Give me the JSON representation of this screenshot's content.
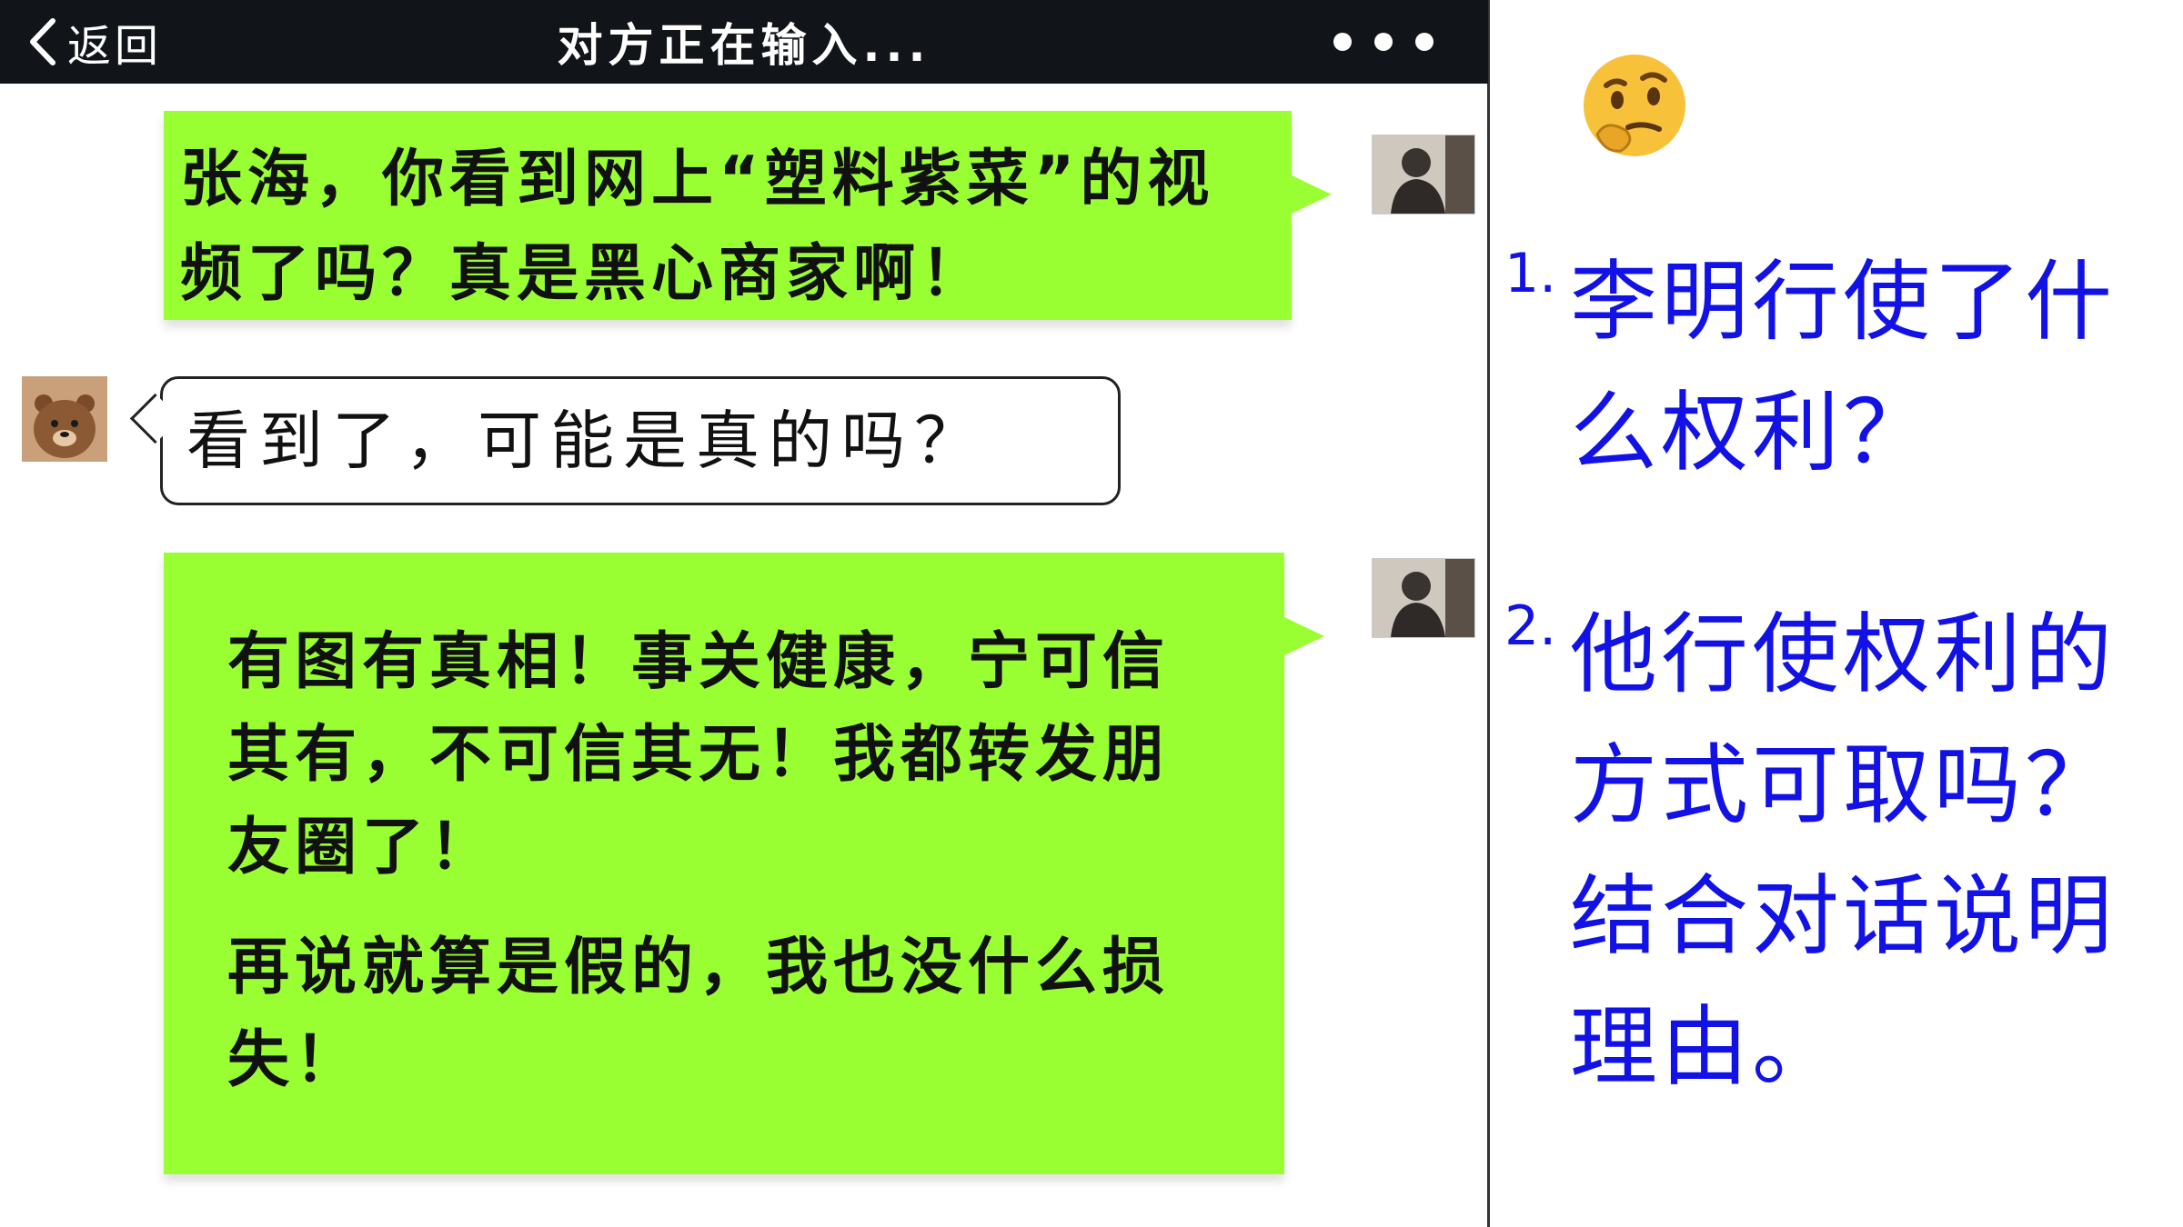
{
  "nav": {
    "back_label": "返回",
    "title": "对方正在输入..."
  },
  "messages": [
    {
      "side": "right",
      "text": "张海，你看到网上“塑料紫菜”的视频了吗？真是黑心商家啊！"
    },
    {
      "side": "left",
      "text": "看到了，可能是真的吗？"
    },
    {
      "side": "right",
      "paragraphs": [
        "有图有真相！事关健康，宁可信其有，不可信其无！我都转发朋友圈了！",
        "再说就算是假的，我也没什么损失！"
      ]
    }
  ],
  "questions": [
    {
      "num": "1.",
      "text": "李明行使了什么权利？"
    },
    {
      "num": "2.",
      "text": "他行使权利的方式可取吗？结合对话说明理由。"
    }
  ],
  "icons": {
    "thinking": "thinking-face-icon",
    "back": "chevron-left-icon",
    "more": "more-dots-icon"
  },
  "colors": {
    "nav_bg": "#111418",
    "sent_bubble": "#99ff33",
    "question_text": "#1212e6"
  }
}
